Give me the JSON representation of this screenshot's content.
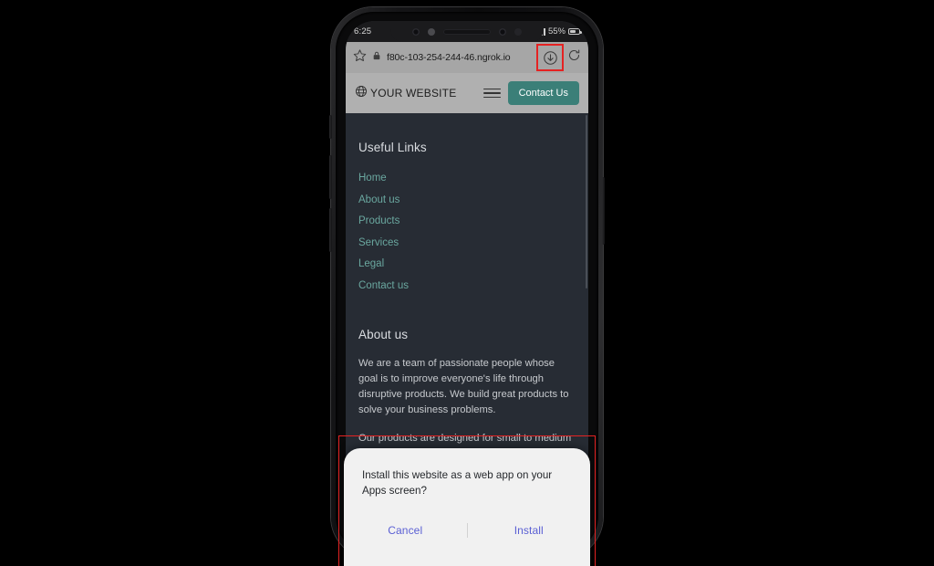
{
  "status_bar": {
    "time": "6:25",
    "battery_percent": "55%",
    "wifi_icon": "wifi-icon",
    "signal_icon": "signal-bars-icon",
    "battery_icon": "battery-icon"
  },
  "browser": {
    "url": "f80c-103-254-244-46.ngrok.io",
    "star_icon": "star-icon",
    "lock_icon": "lock-icon",
    "download_icon": "download-icon",
    "refresh_icon": "refresh-icon",
    "download_highlighted": true,
    "highlight_color": "#e52222"
  },
  "site_header": {
    "logo_icon": "globe-icon",
    "brand_name": "YOUR WEBSITE",
    "menu_icon": "hamburger-menu-icon",
    "contact_label": "Contact Us",
    "contact_color": "#3b7f78"
  },
  "content": {
    "useful_links_title": "Useful Links",
    "links": [
      {
        "label": "Home"
      },
      {
        "label": "About us"
      },
      {
        "label": "Products"
      },
      {
        "label": "Services"
      },
      {
        "label": "Legal"
      },
      {
        "label": "Contact us"
      }
    ],
    "link_color": "#6aa79f",
    "about_title": "About us",
    "about_paragraphs": [
      "We are a team of passionate people whose goal is to improve everyone's life through disruptive products. We build great products to solve your business problems.",
      "Our products are designed for small to medium size companies willing to optimize their"
    ],
    "background_color": "#272c34"
  },
  "install_dialog": {
    "message": "Install this website as a web app on your Apps screen?",
    "cancel_label": "Cancel",
    "install_label": "Install",
    "button_color": "#5a5fd4",
    "background_color": "#f1f1f1"
  }
}
